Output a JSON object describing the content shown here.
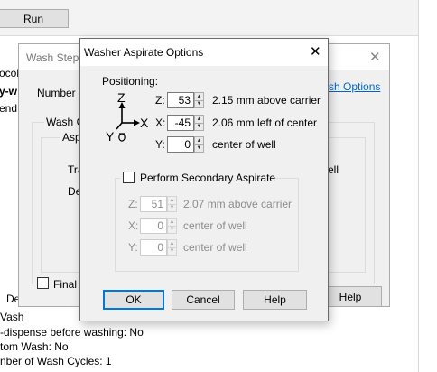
{
  "background": {
    "run_label": "Run",
    "side_labels": [
      "ocol",
      "y-w",
      "end"
    ],
    "bottom_lines": [
      "De",
      "Vash",
      "-dispense before washing: No",
      "tom Wash: No",
      "nber of Wash Cycles: 1"
    ]
  },
  "wash_step": {
    "title": "Wash Step fo",
    "number_label": "Number of",
    "wash_options_link": "sh Options",
    "wash_cycle_group": "Wash Cy",
    "aspirate_label": "Aspi",
    "tra_label": "Tra",
    "del_label": "Del",
    "ell_label": "ell",
    "final_label": "Final A",
    "help_label": "Help"
  },
  "dialog": {
    "title": "Washer Aspirate Options",
    "positioning_label": "Positioning:",
    "axis_icon_labels": {
      "z": "Z",
      "x": "X",
      "y": "Y"
    },
    "primary": {
      "z": {
        "label": "Z:",
        "value": "53",
        "description": "2.15 mm above carrier"
      },
      "x": {
        "label": "X:",
        "value": "-45",
        "description": "2.06 mm left of center"
      },
      "y": {
        "label": "Y:",
        "value": "0",
        "description": "center of well"
      }
    },
    "secondary_checkbox_label": "Perform Secondary Aspirate",
    "secondary": {
      "z": {
        "label": "Z:",
        "value": "51",
        "description": "2.07 mm above carrier"
      },
      "x": {
        "label": "X:",
        "value": "0",
        "description": "center of well"
      },
      "y": {
        "label": "Y:",
        "value": "0",
        "description": "center of well"
      }
    },
    "ok_label": "OK",
    "cancel_label": "Cancel",
    "help_label": "Help"
  }
}
